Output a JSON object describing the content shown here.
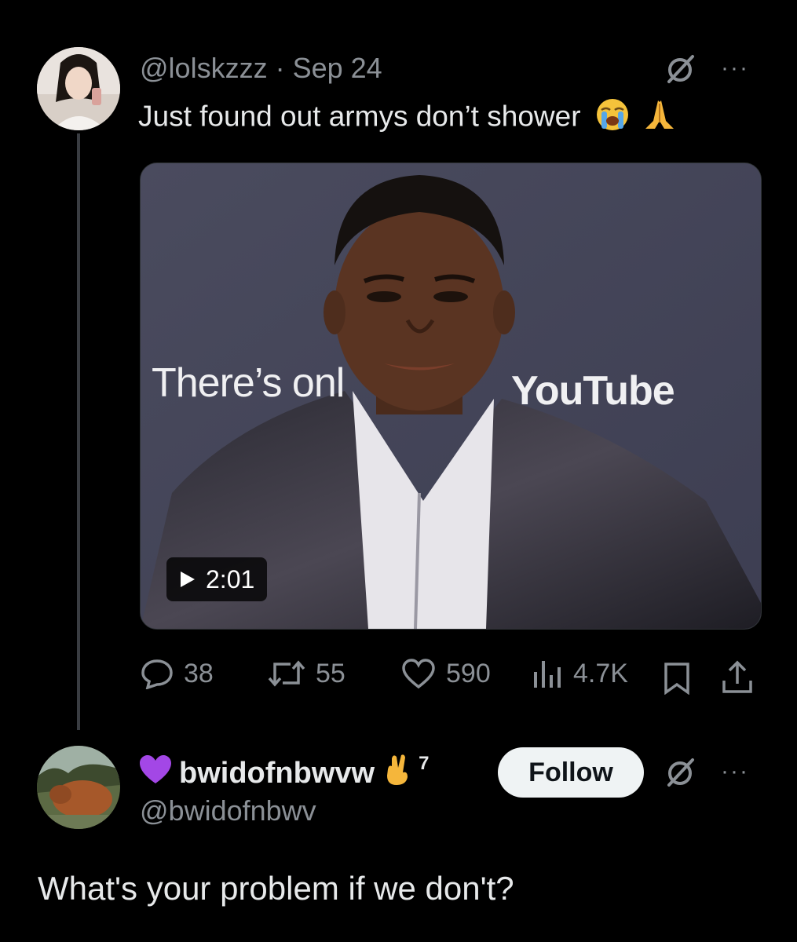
{
  "original_post": {
    "handle": "@lolskzzz",
    "separator": "·",
    "date": "Sep 24",
    "text": "Just found out armys don’t shower",
    "text_emojis": [
      "loudly-crying-face",
      "folded-hands"
    ],
    "more_label": "···",
    "media": {
      "type": "video",
      "duration": "2:01",
      "backdrop_text_left": "There’s onl",
      "backdrop_text_right": "YouTube"
    },
    "metrics": {
      "replies": "38",
      "reposts": "55",
      "likes": "590",
      "views": "4.7K"
    }
  },
  "reply": {
    "display_name": "bwidofnbwvw",
    "name_prefix_emoji": "purple-heart",
    "name_suffix_emoji": "crossed-fingers",
    "badge_number": "7",
    "handle": "@bwidofnbwv",
    "follow_label": "Follow",
    "more_label": "···",
    "text": "What's your problem if we don't?"
  },
  "colors": {
    "background": "#000000",
    "primary_text": "#e7e9ea",
    "secondary_text": "#8b9096",
    "follow_bg": "#eff3f4",
    "thread_line": "#3a3d42"
  }
}
